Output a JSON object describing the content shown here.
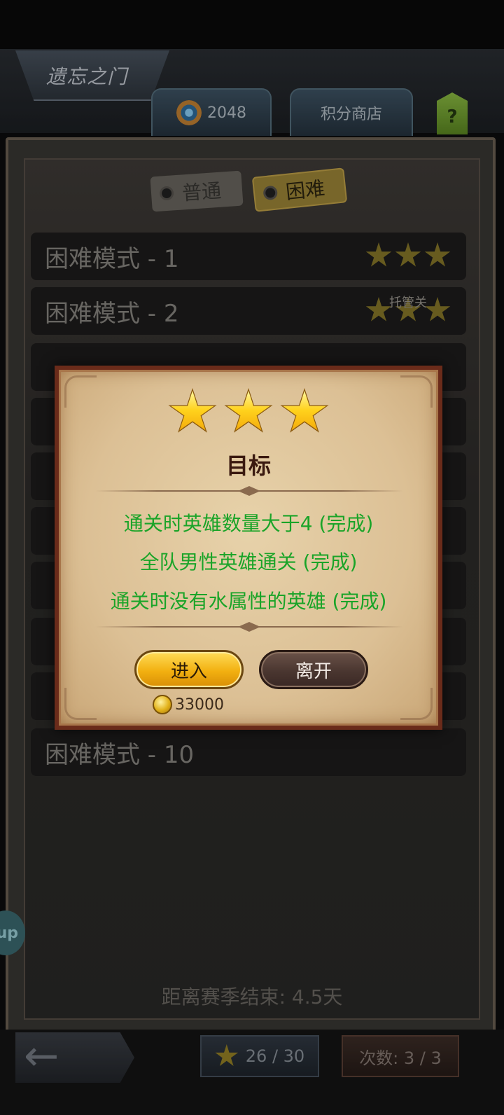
{
  "header": {
    "title": "遗忘之门",
    "currency_value": "2048",
    "shop_label": "积分商店",
    "help_label": "?"
  },
  "tabs": {
    "normal": "普通",
    "hard": "困难"
  },
  "levels": [
    {
      "label": "困难模式 - 1",
      "stars": 3
    },
    {
      "label": "困难模式 - 2",
      "stars": 3
    },
    {
      "label": "困难模式 - 10",
      "stars": 0
    }
  ],
  "auto_label": "托管关",
  "season": {
    "text": "距离赛季结束: 4.5天"
  },
  "bottom": {
    "stars_progress": "26 / 30",
    "attempts": "次数: 3 / 3",
    "side_badge": "up"
  },
  "popup": {
    "stars_earned": 3,
    "title": "目标",
    "objectives": [
      "通关时英雄数量大于4 (完成)",
      "全队男性英雄通关 (完成)",
      "通关时没有水属性的英雄 (完成)"
    ],
    "objective_color": "#1aa428",
    "enter_label": "进入",
    "leave_label": "离开",
    "cost": "33000"
  },
  "icons": {
    "back": "arrow-left-icon",
    "currency": "gem-medal-icon",
    "star": "star-icon",
    "coin": "coin-icon"
  }
}
